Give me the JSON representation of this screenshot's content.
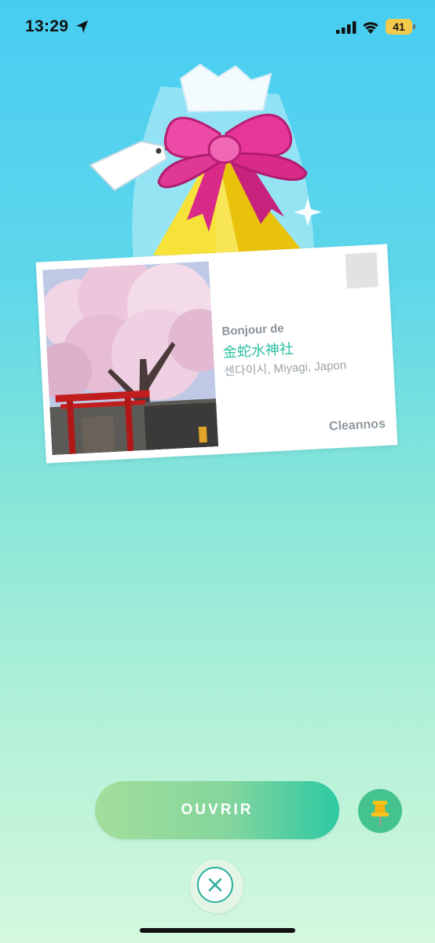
{
  "status_bar": {
    "time": "13:29",
    "battery_level": "41",
    "icons": [
      "location-arrow-icon",
      "signal-icon",
      "wifi-icon",
      "battery-icon"
    ]
  },
  "postcard": {
    "from_label": "Bonjour de",
    "location_name": "金蛇水神社",
    "location_region": "센다이시, Miyagi, Japon",
    "sender": "Cleannos"
  },
  "actions": {
    "open_label": "OUVRIR",
    "pin_icon": "pushpin-icon",
    "close_icon": "close-icon"
  },
  "colors": {
    "accent_green": "#2cc0a4",
    "ribbon_pink": "#e8359a",
    "gift_yellow": "#f6dc28"
  }
}
